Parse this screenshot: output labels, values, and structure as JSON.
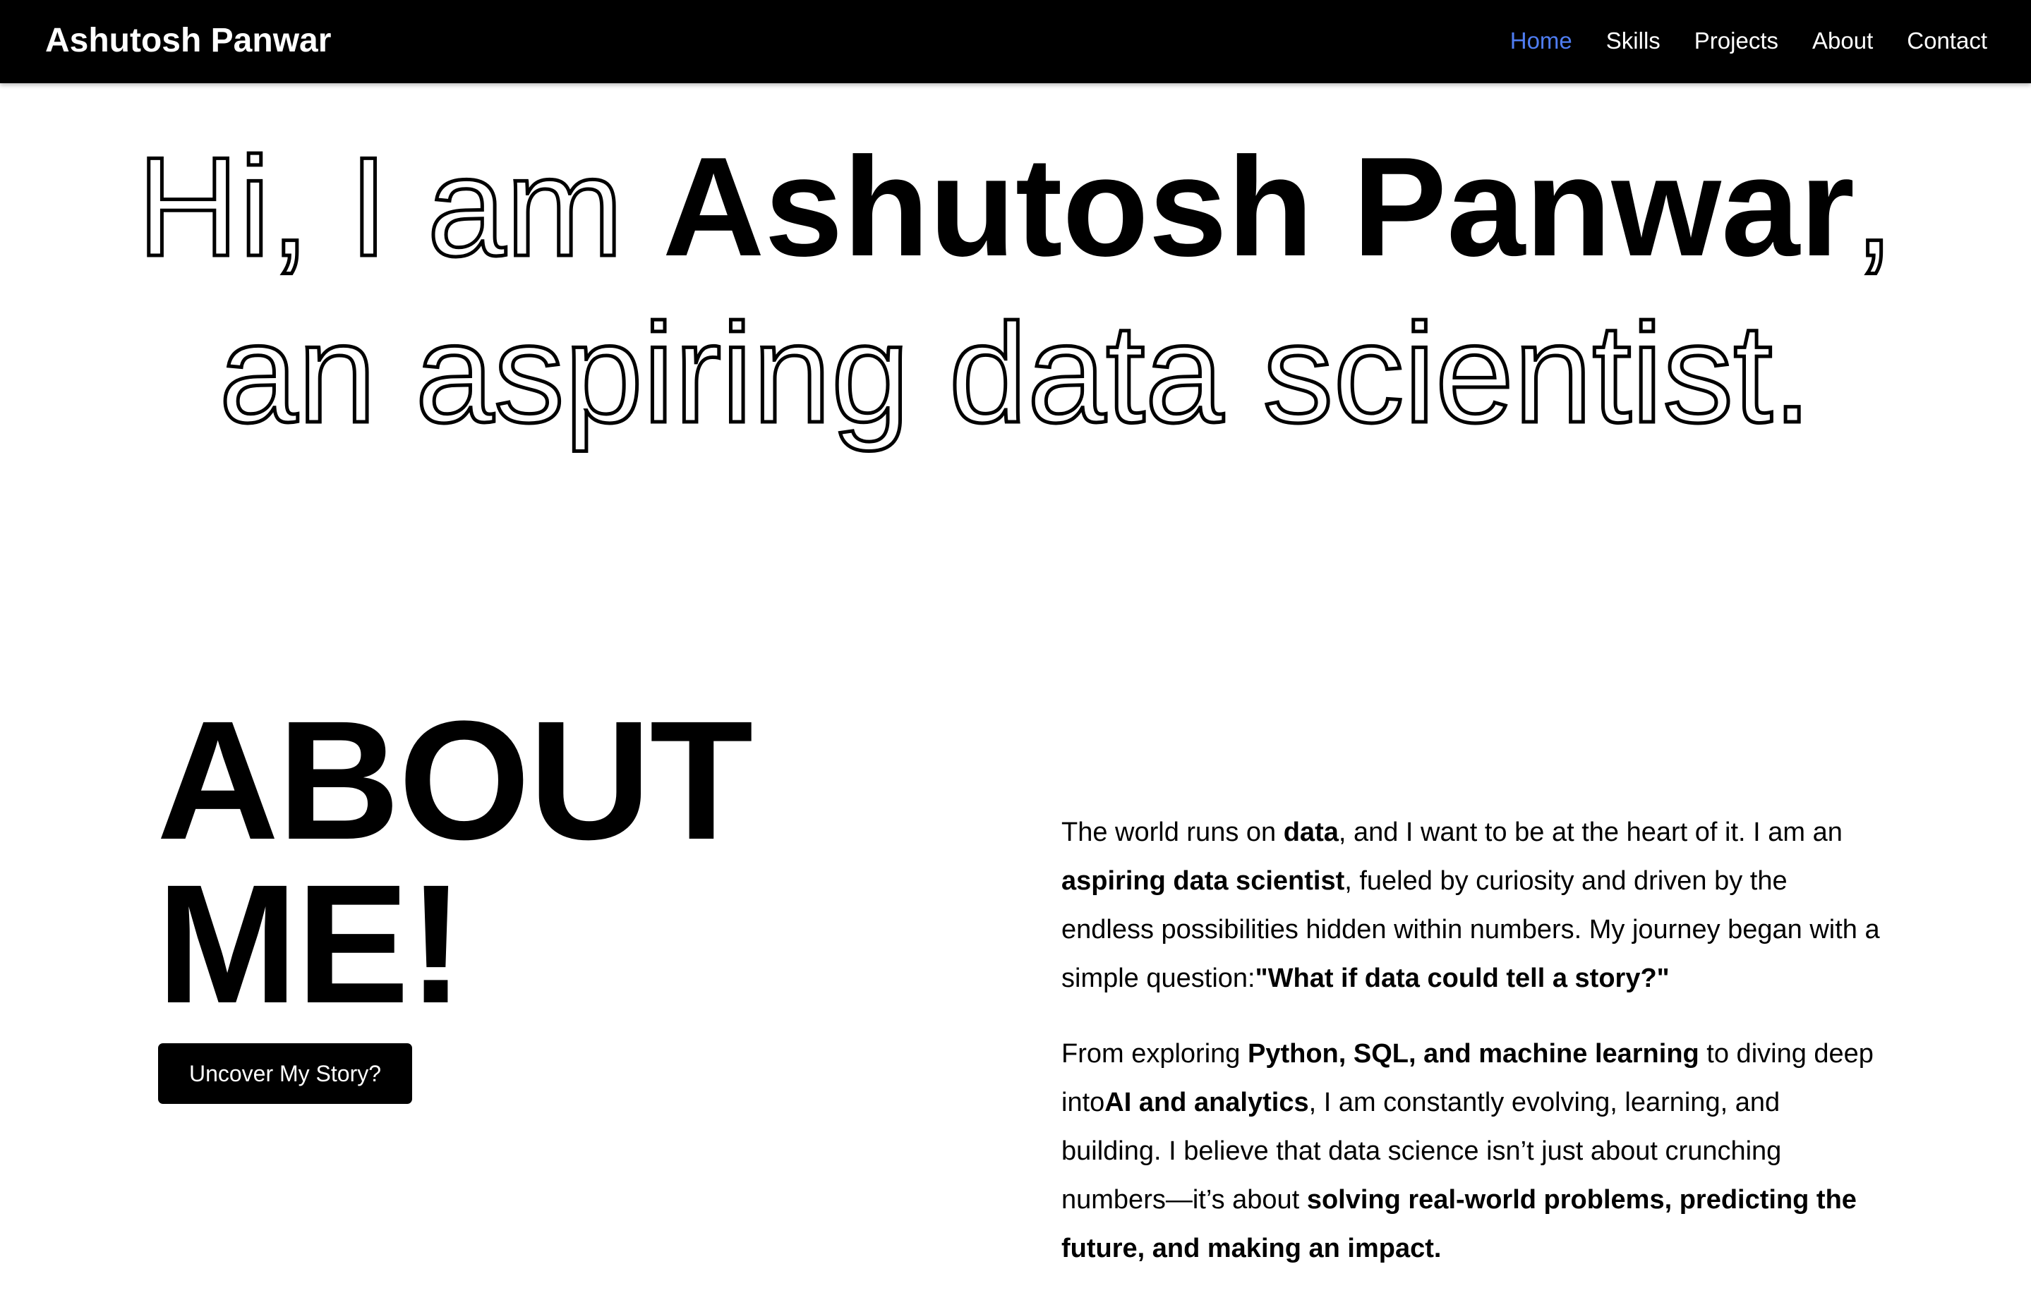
{
  "navbar": {
    "brand": "Ashutosh Panwar",
    "links": [
      "Home",
      "Skills",
      "Projects",
      "About",
      "Contact"
    ],
    "active_color": "#4f7df2"
  },
  "hero": {
    "line1_prefix": "Hi, I am ",
    "line1_name": "Ashutosh Panwar",
    "line1_suffix": ",",
    "line2": "an aspiring data scientist."
  },
  "about": {
    "title_line1": "ABOUT",
    "title_line2": "ME!",
    "button_label": "Uncover My Story?",
    "para1": [
      "The world runs on ",
      "data",
      ", and I want to be at the heart of it. I am an ",
      "aspiring data scientist",
      ", fueled by curiosity and driven by the endless possibilities hidden within numbers. My journey began with a simple question:",
      "\"What if data could tell a story?\""
    ],
    "para2": [
      "From exploring ",
      "Python, SQL, and machine learning",
      " to diving deep into",
      "AI and analytics",
      ", I am constantly evolving, learning, and building. I believe that data science isn’t just about crunching numbers—it’s about ",
      "solving real-world problems, predicting the future, and making an impact."
    ]
  }
}
